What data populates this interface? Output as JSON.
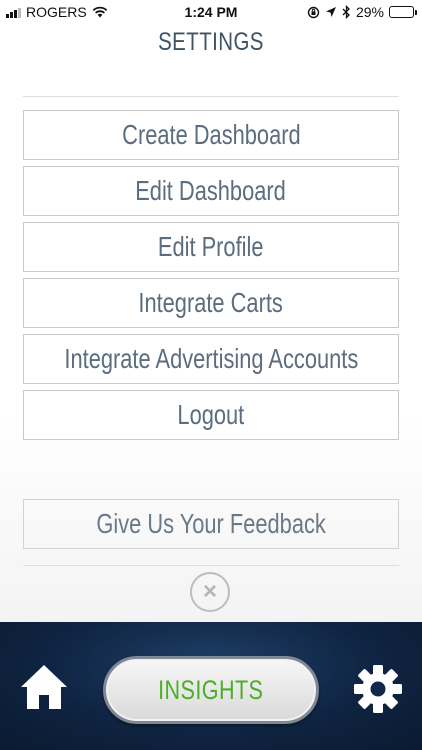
{
  "status_bar": {
    "carrier": "ROGERS",
    "time": "1:24 PM",
    "battery": "29%",
    "battery_level": 0.29
  },
  "header": {
    "title": "SETTINGS"
  },
  "menu": {
    "items": [
      {
        "label": "Create Dashboard"
      },
      {
        "label": "Edit Dashboard"
      },
      {
        "label": "Edit Profile"
      },
      {
        "label": "Integrate Carts"
      },
      {
        "label": "Integrate Advertising Accounts"
      },
      {
        "label": "Logout"
      }
    ],
    "feedback_label": "Give Us Your Feedback",
    "close_icon": "close-icon"
  },
  "bottom_nav": {
    "home_icon": "home-icon",
    "insights_label": "INSIGHTS",
    "settings_icon": "gear-icon"
  },
  "colors": {
    "title": "#3e5366",
    "menu_text": "#5b6d7e",
    "insights_text": "#4cae25",
    "nav_background": "#0f2442"
  }
}
